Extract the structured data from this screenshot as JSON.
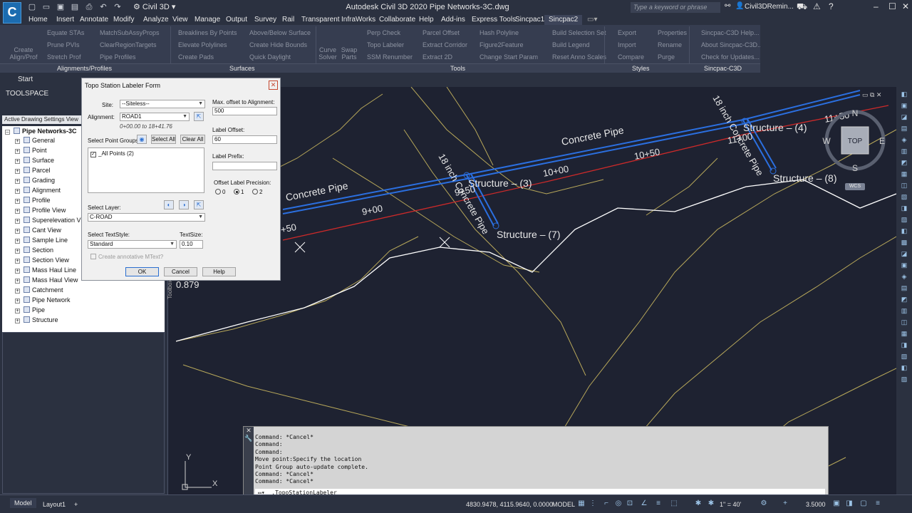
{
  "app": {
    "logo_text": "C",
    "workspace": "Civil 3D",
    "window_title": "Autodesk Civil 3D 2020   Pipe Networks-3C.dwg",
    "search_placeholder": "Type a keyword or phrase",
    "user": "Civil3DRemin..."
  },
  "menu": [
    "Home",
    "Insert",
    "Annotate",
    "Modify",
    "Analyze",
    "View",
    "Manage",
    "Output",
    "Survey",
    "Rail",
    "Transparent",
    "InfraWorks",
    "Collaborate",
    "Help",
    "Add-ins",
    "Express Tools",
    "Sincpac1",
    "Sincpac2"
  ],
  "menu_active": "Sincpac2",
  "ribbon": {
    "create_align_prof": "Create Align/Prof",
    "items_col1": [
      "Equate STAs",
      "Prune PVIs",
      "Stretch Prof"
    ],
    "items_col2": [
      "MatchSubAssyProps",
      "ClearRegionTargets",
      "Pipe Profiles"
    ],
    "items_col3": [
      "Breaklines By Points",
      "Elevate Polylines",
      "Create Pads"
    ],
    "items_col4": [
      "Above/Below Surface",
      "Create Hide Bounds",
      "Quick Daylight"
    ],
    "curve_solver": "Curve Solver",
    "swap_parts": "Swap Parts",
    "items_col5": [
      "Perp Check",
      "Topo Labeler",
      "SSM Renumber"
    ],
    "items_col6": [
      "Parcel Offset",
      "Extract Corridor",
      "Extract 2D"
    ],
    "items_col7": [
      "Hash Polyline",
      "Figure2Feature",
      "Change Start Param"
    ],
    "items_col8": [
      "Build Selection Set",
      "Build Legend",
      "Reset Anno Scales"
    ],
    "items_col9": [
      "Export",
      "Import",
      "Compare"
    ],
    "items_col10": [
      "Properties",
      "Rename",
      "Purge"
    ],
    "items_col11": [
      "Sincpac-C3D Help...",
      "About Sincpac-C3D...",
      "Check for Updates..."
    ],
    "panels": [
      "Alignments/Profiles",
      "Surfaces",
      "Tools",
      "Styles",
      "Sincpac-C3D"
    ]
  },
  "tabs": {
    "start": "Start"
  },
  "toolspace": {
    "title": "TOOLSPACE",
    "tab": "Active Drawing Settings View",
    "root": "Pipe Networks-3C",
    "items": [
      "General",
      "Point",
      "Surface",
      "Parcel",
      "Grading",
      "Alignment",
      "Profile",
      "Profile View",
      "Superelevation View",
      "Cant View",
      "Sample Line",
      "Section",
      "Section View",
      "Mass Haul Line",
      "Mass Haul View",
      "Catchment",
      "Pipe Network",
      "Pipe",
      "Structure"
    ],
    "toolbox_label": "Toolbox"
  },
  "dialog": {
    "title": "Topo Station Labeler Form",
    "site_label": "Site:",
    "site_value": "--Siteless--",
    "alignment_label": "Alignment:",
    "alignment_value": "ROAD1",
    "station_range": "0+00.00 to 18+41.76",
    "point_groups_label": "Select Point Groups",
    "select_all": "Select All",
    "clear_all": "Clear All",
    "point_group_item": "_All Points (2)",
    "layer_label": "Select Layer:",
    "layer_value": "C-ROAD",
    "textstyle_label": "Select TextStyle:",
    "textstyle_value": "Standard",
    "textsize_label": "TextSize:",
    "textsize_value": "0.10",
    "annotative_label": "Create annotative MText?",
    "max_offset_label": "Max. offset to Alignment:",
    "max_offset_value": "500",
    "label_offset_label": "Label Offset:",
    "label_offset_value": "60",
    "label_prefix_label": "Label Prefix:",
    "label_prefix_value": "",
    "precision_label": "Offset Label Precision:",
    "precision_options": [
      "0",
      "1",
      "2"
    ],
    "precision_selected": "1",
    "ok": "OK",
    "cancel": "Cancel",
    "help": "Help"
  },
  "drawing": {
    "labels": {
      "concrete_pipe_top": "Concrete Pipe",
      "concrete_pipe_left": "Concrete Pipe",
      "pipe_18_a": "18 inch Concrete Pipe",
      "pipe_18_b": "18 inch Concrete Pipe",
      "structure_3": "Structure – (3)",
      "structure_4": "Structure – (4)",
      "structure_7": "Structure – (7)",
      "structure_8": "Structure – (8)",
      "sta_9": "9+00",
      "sta_10": "10+00",
      "sta_1050": "10+50",
      "sta_11": "11+00",
      "sta_1150": "11+50",
      "sta_950": "9+50",
      "sta_850": "+50",
      "elev": "0.879"
    },
    "viewcube": {
      "top": "TOP",
      "n": "N",
      "s": "S",
      "e": "E",
      "w": "W",
      "wcs": "WCS"
    },
    "ucs": {
      "x": "X",
      "y": "Y"
    }
  },
  "command_line": {
    "history": [
      "Command: *Cancel*",
      "Command:",
      "Command:",
      "Move point:Specify the location",
      "Point Group auto-update complete.",
      "Command: *Cancel*",
      "Command: *Cancel*"
    ],
    "prompt": "_.TopoStationLabeler"
  },
  "status": {
    "tabs": [
      "Model",
      "Layout1"
    ],
    "coords": "4830.9478, 4115.9640, 0.0000",
    "space": "MODEL",
    "scale": "1\" = 40'",
    "zoom": "3.5000"
  },
  "colors": {
    "alignment": "#cc2a2a",
    "pipe": "#2b6fe0",
    "contour": "#b8a85a",
    "ground": "#ffffff"
  }
}
